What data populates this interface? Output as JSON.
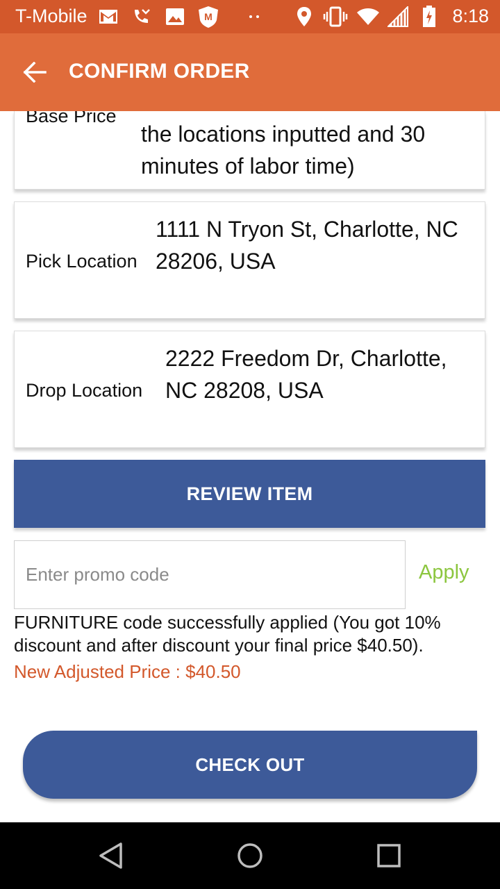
{
  "status_bar": {
    "carrier": "T-Mobile",
    "time": "8:18",
    "icons": [
      "gmail-icon",
      "missed-call-icon",
      "image-icon",
      "mcafee-icon",
      "dots-icon",
      "location-icon",
      "vibrate-icon",
      "wifi-icon",
      "signal-icon",
      "battery-icon"
    ]
  },
  "app_bar": {
    "title": "CONFIRM ORDER",
    "back_icon": "arrow-left-icon"
  },
  "cards": {
    "partial": {
      "label_cut": "Base Price",
      "value": "the locations inputted and 30 minutes of labor time)"
    },
    "pick": {
      "label": "Pick Location",
      "value": "1111 N Tryon St, Charlotte, NC 28206, USA"
    },
    "drop": {
      "label": "Drop Location",
      "value": "2222 Freedom Dr, Charlotte, NC 28208, USA"
    }
  },
  "review_button": "REVIEW ITEM",
  "promo": {
    "placeholder": "Enter promo code",
    "value": "",
    "apply_label": "Apply"
  },
  "success_message": "FURNITURE code successfully applied (You got 10% discount and after discount your final price $40.50).",
  "adjusted_price": "New Adjusted Price : $40.50",
  "checkout_button": "CHECK OUT",
  "colors": {
    "status_bar": "#d3582b",
    "app_bar": "#e06c3b",
    "primary_button": "#3d5a99",
    "apply": "#8cc63f",
    "adjusted_price": "#d3582b"
  },
  "nav_bar": {
    "icons": [
      "back-triangle-icon",
      "home-circle-icon",
      "recents-square-icon"
    ]
  }
}
